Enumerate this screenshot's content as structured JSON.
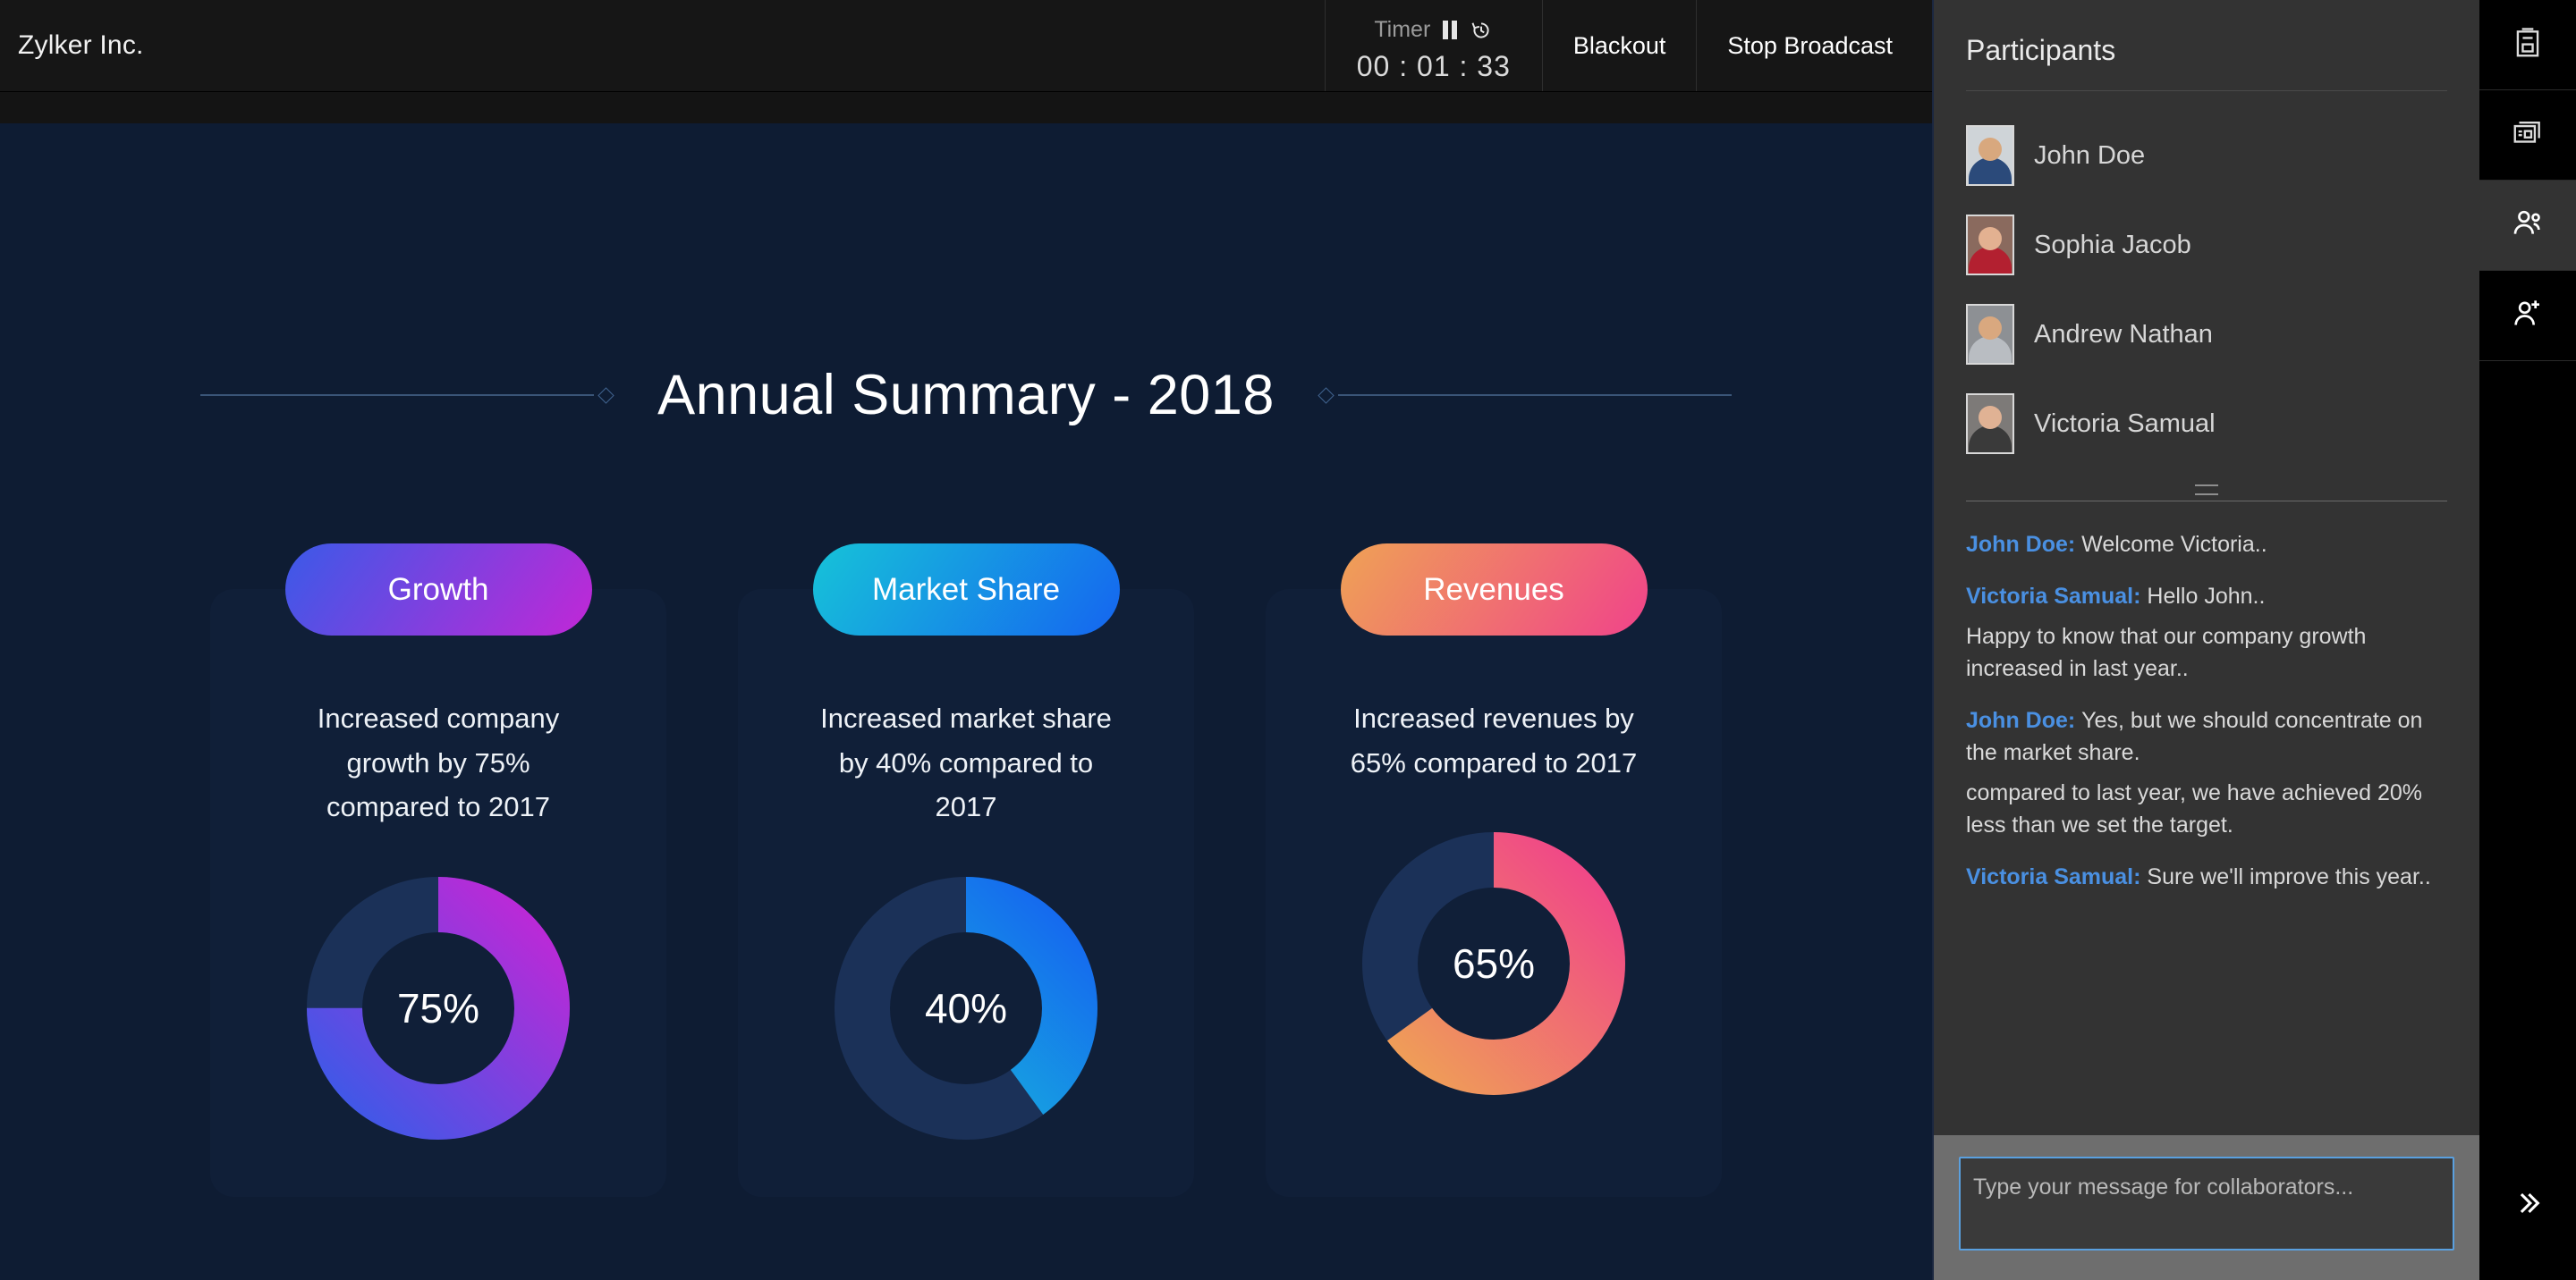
{
  "header": {
    "brand": "Zylker Inc.",
    "timer_label": "Timer",
    "timer_value": "00 : 01 : 33",
    "pause_icon": "pause-icon",
    "reset_icon": "reset-timer-icon",
    "blackout_label": "Blackout",
    "stop_broadcast_label": "Stop Broadcast"
  },
  "slide": {
    "title": "Annual Summary - 2018",
    "cards": [
      {
        "label": "Growth",
        "description": "Increased company growth by 75% compared to 2017",
        "percent_label": "75%",
        "percent": 75,
        "gradient_from": "#3a5ae8",
        "gradient_to": "#c227d6"
      },
      {
        "label": "Market Share",
        "description": "Increased market share by 40% compared to 2017",
        "percent_label": "40%",
        "percent": 40,
        "gradient_from": "#16c3d8",
        "gradient_to": "#1565f0"
      },
      {
        "label": "Revenues",
        "description": "Increased revenues by 65% compared to 2017",
        "percent_label": "65%",
        "percent": 65,
        "gradient_from": "#efa255",
        "gradient_to": "#f0438a"
      }
    ],
    "track_color": "#1b3158",
    "background_color": "#0e1c33"
  },
  "sidebar": {
    "title": "Participants",
    "participants": [
      {
        "name": "John Doe",
        "avatar_bg": "#cfd4d8",
        "skin": "#d8a87e",
        "shirt": "#2b4a7a"
      },
      {
        "name": "Sophia Jacob",
        "avatar_bg": "#8a6a5e",
        "skin": "#e3b191",
        "shirt": "#b32030"
      },
      {
        "name": "Andrew Nathan",
        "avatar_bg": "#8d9094",
        "skin": "#d9a87f",
        "shirt": "#b9bdc2"
      },
      {
        "name": "Victoria Samual",
        "avatar_bg": "#7d7a78",
        "skin": "#e0b294",
        "shirt": "#3a3a3a"
      }
    ],
    "chat": [
      {
        "speaker": "John Doe:",
        "lines": [
          "Welcome Victoria.."
        ]
      },
      {
        "speaker": "Victoria Samual:",
        "lines": [
          "Hello John..",
          "Happy to know that our company growth increased in last year.."
        ]
      },
      {
        "speaker": "John Doe:",
        "lines": [
          "Yes, but we should concentrate on the market share.",
          "compared to last year, we have achieved 20% less than we set the target."
        ]
      },
      {
        "speaker": "Victoria Samual:",
        "lines": [
          "Sure we'll improve this year.."
        ]
      }
    ],
    "composer_placeholder": "Type your message for collaborators...",
    "composer_value": "",
    "speaker_color": "#4a90e2"
  },
  "rail": {
    "items": [
      {
        "icon": "notes-clipboard-icon",
        "active": false
      },
      {
        "icon": "slides-layout-icon",
        "active": false
      },
      {
        "icon": "participants-icon",
        "active": true
      },
      {
        "icon": "add-person-icon",
        "active": false
      }
    ],
    "collapse_icon": "chevron-double-right-icon"
  }
}
